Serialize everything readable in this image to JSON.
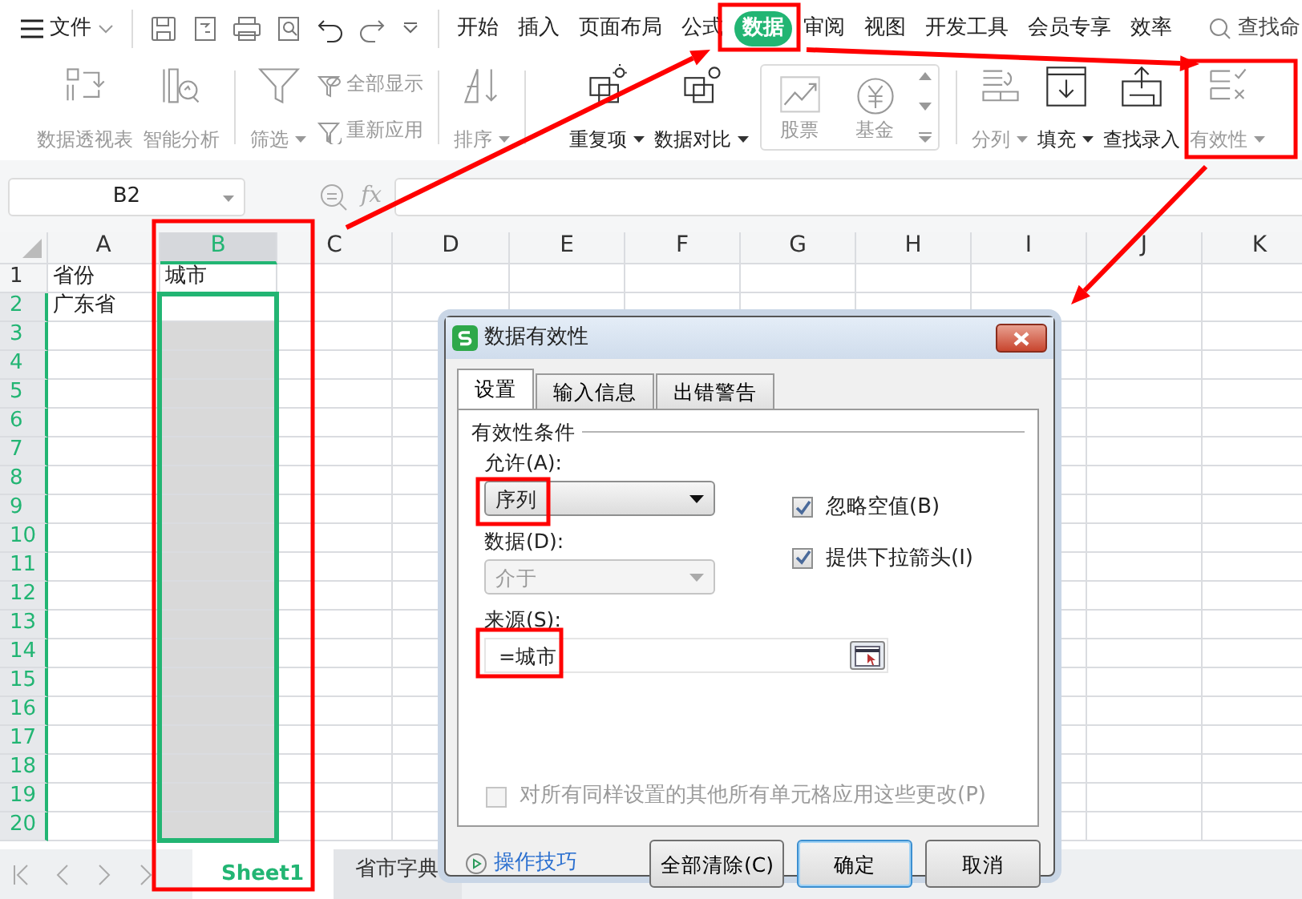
{
  "menu": {
    "label": "文件"
  },
  "ribbon_tabs": [
    {
      "label": "开始",
      "selected": false
    },
    {
      "label": "插入",
      "selected": false
    },
    {
      "label": "页面布局",
      "selected": false
    },
    {
      "label": "公式",
      "selected": false
    },
    {
      "label": "数据",
      "selected": true
    },
    {
      "label": "审阅",
      "selected": false
    },
    {
      "label": "视图",
      "selected": false
    },
    {
      "label": "开发工具",
      "selected": false
    },
    {
      "label": "会员专享",
      "selected": false
    },
    {
      "label": "效率",
      "selected": false
    }
  ],
  "search": {
    "label": "查找命"
  },
  "ribbon_groups": [
    [
      {
        "kind": "large",
        "label": "数据透视表",
        "disabled": true,
        "dropdown": false
      },
      {
        "kind": "large",
        "label": "智能分析",
        "disabled": true,
        "dropdown": false
      }
    ],
    [
      {
        "kind": "large",
        "label": "筛选",
        "disabled": true,
        "dropdown": true
      },
      {
        "kind": "small",
        "label": "全部显示",
        "disabled": true,
        "dropdown": false
      },
      {
        "kind": "small",
        "label": "重新应用",
        "disabled": true,
        "dropdown": false
      }
    ],
    [
      {
        "kind": "large",
        "label": "排序",
        "disabled": true,
        "dropdown": true
      }
    ],
    [
      {
        "kind": "large",
        "label": "重复项",
        "disabled": false,
        "dropdown": true
      },
      {
        "kind": "large",
        "label": "数据对比",
        "disabled": false,
        "dropdown": true
      },
      {
        "kind": "gallery",
        "label": "股票",
        "disabled": true,
        "dropdown": false
      },
      {
        "kind": "gallery",
        "label": "基金",
        "disabled": true,
        "dropdown": false
      }
    ],
    [
      {
        "kind": "large",
        "label": "分列",
        "disabled": true,
        "dropdown": true
      },
      {
        "kind": "large",
        "label": "填充",
        "disabled": false,
        "dropdown": true
      },
      {
        "kind": "large",
        "label": "查找录入",
        "disabled": false,
        "dropdown": false
      },
      {
        "kind": "large",
        "label": "有效性",
        "disabled": true,
        "dropdown": true
      }
    ]
  ],
  "formula_bar": {
    "name_box": "B2",
    "function_label": "fx"
  },
  "grid": {
    "columns": [
      {
        "label": "A",
        "selected": false
      },
      {
        "label": "B",
        "selected": true
      },
      {
        "label": "C",
        "selected": false
      },
      {
        "label": "D",
        "selected": false
      },
      {
        "label": "E",
        "selected": false
      },
      {
        "label": "F",
        "selected": false
      },
      {
        "label": "G",
        "selected": false
      },
      {
        "label": "H",
        "selected": false
      },
      {
        "label": "I",
        "selected": false
      },
      {
        "label": "J",
        "selected": false
      },
      {
        "label": "K",
        "selected": false
      }
    ],
    "rows": [
      {
        "label": "1",
        "selected": false,
        "cells": [
          "省份",
          "城市"
        ]
      },
      {
        "label": "2",
        "selected": true,
        "cells": [
          "广东省"
        ]
      },
      {
        "label": "3",
        "selected": true,
        "cells": []
      },
      {
        "label": "4",
        "selected": true,
        "cells": []
      },
      {
        "label": "5",
        "selected": true,
        "cells": []
      },
      {
        "label": "6",
        "selected": true,
        "cells": []
      },
      {
        "label": "7",
        "selected": true,
        "cells": []
      },
      {
        "label": "8",
        "selected": true,
        "cells": []
      },
      {
        "label": "9",
        "selected": true,
        "cells": []
      },
      {
        "label": "10",
        "selected": true,
        "cells": []
      },
      {
        "label": "11",
        "selected": true,
        "cells": []
      },
      {
        "label": "12",
        "selected": true,
        "cells": []
      },
      {
        "label": "13",
        "selected": true,
        "cells": []
      },
      {
        "label": "14",
        "selected": true,
        "cells": []
      },
      {
        "label": "15",
        "selected": true,
        "cells": []
      },
      {
        "label": "16",
        "selected": true,
        "cells": []
      },
      {
        "label": "17",
        "selected": true,
        "cells": []
      },
      {
        "label": "18",
        "selected": true,
        "cells": []
      },
      {
        "label": "19",
        "selected": true,
        "cells": []
      },
      {
        "label": "20",
        "selected": true,
        "cells": []
      }
    ]
  },
  "sheet_tabs": [
    {
      "label": "Sheet1",
      "selected": true
    },
    {
      "label": "省市字典",
      "selected": false
    }
  ],
  "dialog": {
    "title": "数据有效性",
    "tabs": [
      {
        "label": "设置",
        "selected": true
      },
      {
        "label": "输入信息",
        "selected": false
      },
      {
        "label": "出错警告",
        "selected": false
      }
    ],
    "group_label": "有效性条件",
    "allow": {
      "label": "允许(A):",
      "value": "序列",
      "disabled": false
    },
    "data": {
      "label": "数据(D):",
      "value": "介于",
      "disabled": true
    },
    "source": {
      "label": "来源(S):",
      "value": "=城市"
    },
    "checkboxes": [
      {
        "label": "忽略空值(B)",
        "checked": true,
        "disabled": false
      },
      {
        "label": "提供下拉箭头(I)",
        "checked": true,
        "disabled": false
      }
    ],
    "apply_all": {
      "label": "对所有同样设置的其他所有单元格应用这些更改(P)",
      "checked": false,
      "disabled": true
    },
    "tips_link": "操作技巧",
    "buttons": [
      {
        "label": "全部清除(C)",
        "default": false
      },
      {
        "label": "确定",
        "default": true
      },
      {
        "label": "取消",
        "default": false
      }
    ]
  }
}
